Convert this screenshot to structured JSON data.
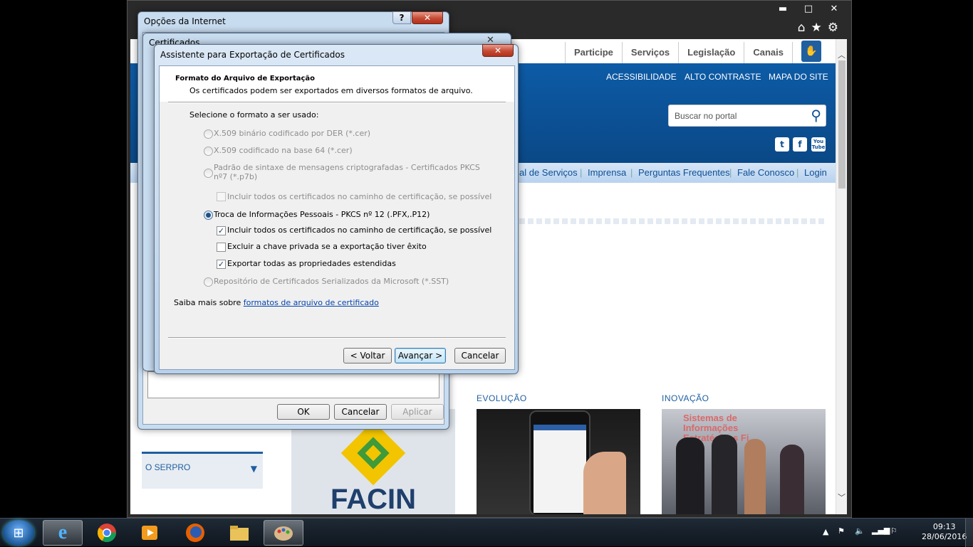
{
  "browser": {
    "window_controls": {
      "minimize": "▬",
      "maximize": "□",
      "close": "✕"
    },
    "tools": {
      "home": "⌂",
      "favorites": "★",
      "settings": "⚙"
    },
    "top_nav": [
      "Participe",
      "Serviços",
      "Legislação",
      "Canais"
    ],
    "accessibility_links": [
      "ACESSIBILIDADE",
      "ALTO CONTRASTE",
      "MAPA DO SITE"
    ],
    "search_placeholder": "Buscar no portal",
    "social": {
      "twitter": "t",
      "facebook": "f",
      "youtube": "You Tube"
    },
    "menu_items": [
      "al de Serviços",
      "Imprensa",
      "Perguntas Frequentes",
      "Fale Conosco",
      "Login"
    ],
    "sections": {
      "evolucao": "EVOLUÇÃO",
      "inovacao": "INOVAÇÃO"
    },
    "serpro_label": "O SERPRO",
    "facin_text": "FACIN",
    "inovacao_card_text": "Sistemas de Informações Estratégicas Fi..."
  },
  "internet_options": {
    "title": "Opções da Internet",
    "buttons": {
      "ok": "OK",
      "cancel": "Cancelar",
      "apply": "Aplicar"
    }
  },
  "certificates": {
    "title": "Certificados",
    "close": "✕"
  },
  "wizard": {
    "title": "Assistente para Exportação de Certificados",
    "close": "✕",
    "header_title": "Formato do Arquivo de Exportação",
    "header_subtitle": "Os certificados podem ser exportados em diversos formatos de arquivo.",
    "select_prompt": "Selecione o formato a ser usado:",
    "options": [
      {
        "label": "X.509 binário codificado por DER (*.cer)",
        "enabled": false,
        "selected": false
      },
      {
        "label": "X.509 codificado na base 64 (*.cer)",
        "enabled": false,
        "selected": false
      },
      {
        "label": "Padrão de sintaxe de mensagens criptografadas - Certificados PKCS",
        "label2": "nº7 (*.p7b)",
        "enabled": false,
        "selected": false
      },
      {
        "label": "Troca de Informações Pessoais - PKCS nº 12 (.PFX,.P12)",
        "enabled": true,
        "selected": true
      },
      {
        "label": "Repositório de Certificados Serializados da Microsoft (*.SST)",
        "enabled": false,
        "selected": false
      }
    ],
    "p7b_include_all": {
      "label": "Incluir todos os certificados no caminho de certificação, se possível",
      "checked": false,
      "enabled": false
    },
    "pfx_checkboxes": [
      {
        "label": "Incluir todos os certificados no caminho de certificação, se possível",
        "checked": true
      },
      {
        "label": "Excluir a chave privada se a exportação tiver êxito",
        "checked": false
      },
      {
        "label": "Exportar todas as propriedades estendidas",
        "checked": true
      }
    ],
    "learn_more_prefix": "Saiba mais sobre ",
    "learn_more_link": "formatos de arquivo de certificado",
    "buttons": {
      "back": "< Voltar",
      "next": "Avançar >",
      "cancel": "Cancelar"
    }
  },
  "taskbar": {
    "clock_time": "09:13",
    "clock_date": "28/06/2016"
  }
}
